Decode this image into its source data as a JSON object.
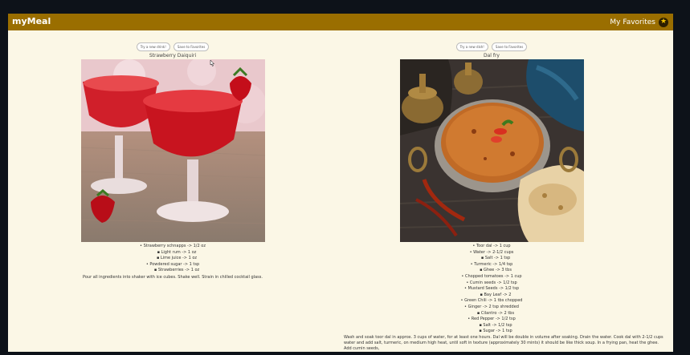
{
  "header": {
    "brand": "myMeal",
    "favorites_label": "My Favorites",
    "favorites_icon": "★"
  },
  "left": {
    "try_label": "Try a new drink!",
    "save_label": "Save to Favorites",
    "title": "Strawberry Daiquiri",
    "ingredients": [
      {
        "text": "Strawberry schnapps -> 1/2 oz",
        "level": 1
      },
      {
        "text": "Light rum -> 1 oz",
        "level": 2
      },
      {
        "text": "Lime juice -> 1 oz",
        "level": 2
      },
      {
        "text": "Powdered sugar -> 1 tsp",
        "level": 1
      },
      {
        "text": "Strawberries -> 1 oz",
        "level": 2
      }
    ],
    "instructions": "Pour all ingredients into shaker with ice cubes. Shake well. Strain in chilled cocktail glass."
  },
  "right": {
    "try_label": "Try a new dish!",
    "save_label": "Save to Favorites",
    "title": "Dal fry",
    "ingredients": [
      {
        "text": "Toor dal -> 1 cup",
        "level": 1
      },
      {
        "text": "Water -> 2-1/2 cups",
        "level": 1
      },
      {
        "text": "Salt -> 1 tsp",
        "level": 2
      },
      {
        "text": "Turmeric -> 1/4 tsp",
        "level": 1
      },
      {
        "text": "Ghee -> 3 tbs",
        "level": 2
      },
      {
        "text": "Chopped tomatoes -> 1 cup",
        "level": 1
      },
      {
        "text": "Cumin seeds -> 1/2 tsp",
        "level": 1
      },
      {
        "text": "Mustard Seeds -> 1/2 tsp",
        "level": 1
      },
      {
        "text": "Bay Leaf -> 2",
        "level": 2
      },
      {
        "text": "Green Chili -> 1 tbs chopped",
        "level": 1
      },
      {
        "text": "Ginger -> 2 tsp shredded",
        "level": 1
      },
      {
        "text": "Cilantro -> 2 tbs",
        "level": 2
      },
      {
        "text": "Red Pepper -> 1/2 tsp",
        "level": 1
      },
      {
        "text": "Salt -> 1/2 tsp",
        "level": 2
      },
      {
        "text": "Sugar -> 1 tsp",
        "level": 2
      }
    ],
    "instructions": "Wash and soak toor dal in approx. 3 cups of water, for at least one hours. Dal will be double in volume after soaking. Drain the water. Cook dal with 2-1/2 cups water and add salt, turmeric, on medium high heat, until soft in texture (approximately 30 mints) it should be like thick soup. In a frying pan, heat the ghee. Add cumin seeds,"
  }
}
